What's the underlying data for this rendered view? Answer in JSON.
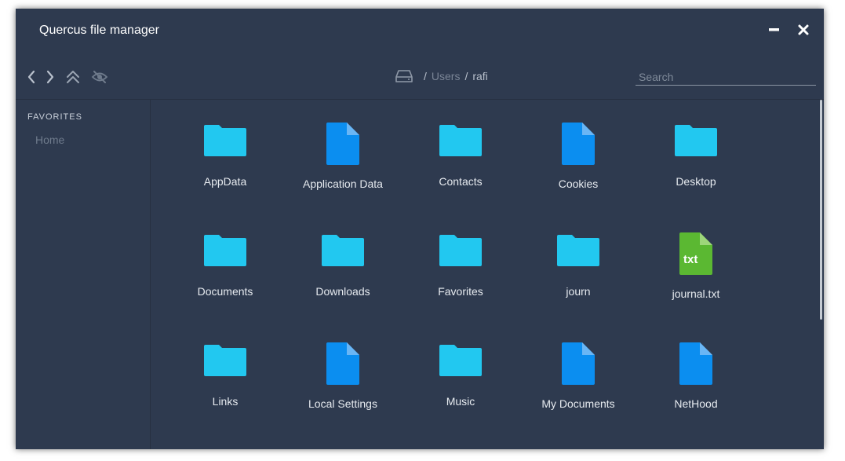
{
  "window": {
    "title": "Quercus file manager"
  },
  "toolbar": {
    "back_icon": "chevron-left",
    "forward_icon": "chevron-right",
    "up_icon": "double-chevron-up",
    "hidden_toggle_icon": "eye-slash",
    "breadcrumb": {
      "drive_icon": "hard-drive",
      "separator": "/",
      "segments": [
        "Users",
        "rafi"
      ]
    },
    "search_placeholder": "Search"
  },
  "sidebar": {
    "header": "FAVORITES",
    "items": [
      {
        "label": "Home"
      }
    ]
  },
  "files": [
    {
      "name": "AppData",
      "type": "folder"
    },
    {
      "name": "Application Data",
      "type": "file"
    },
    {
      "name": "Contacts",
      "type": "folder"
    },
    {
      "name": "Cookies",
      "type": "file"
    },
    {
      "name": "Desktop",
      "type": "folder"
    },
    {
      "name": "Documents",
      "type": "folder"
    },
    {
      "name": "Downloads",
      "type": "folder"
    },
    {
      "name": "Favorites",
      "type": "folder"
    },
    {
      "name": "journ",
      "type": "folder"
    },
    {
      "name": "journal.txt",
      "type": "txt",
      "badge": "txt"
    },
    {
      "name": "Links",
      "type": "folder"
    },
    {
      "name": "Local Settings",
      "type": "file"
    },
    {
      "name": "Music",
      "type": "folder"
    },
    {
      "name": "My Documents",
      "type": "file"
    },
    {
      "name": "NetHood",
      "type": "file"
    }
  ],
  "colors": {
    "window_bg": "#2e3a4f",
    "folder": "#22c8f0",
    "file": "#0b8ef0",
    "file_fold": "#6ab6f5",
    "txt": "#5bb832",
    "txt_fold": "#9dd67a"
  }
}
